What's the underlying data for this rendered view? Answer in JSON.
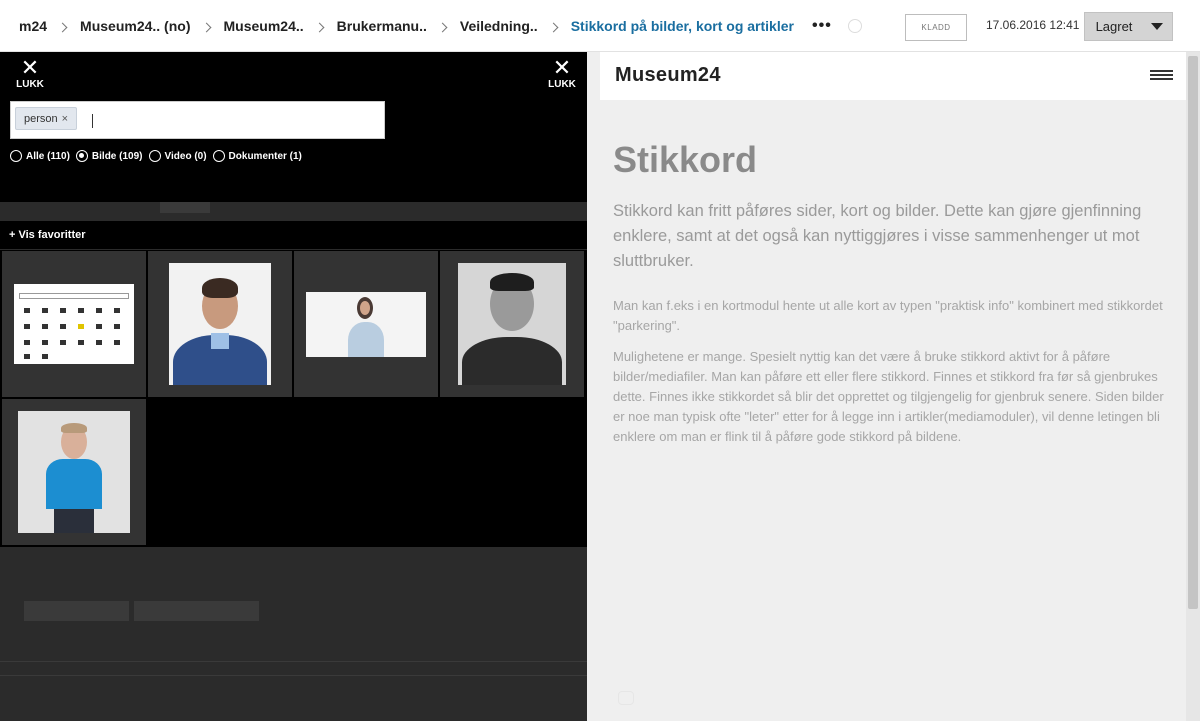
{
  "breadcrumb": {
    "items": [
      "m24",
      "Museum24.. (no)",
      "Museum24..",
      "Brukermanu..",
      "Veiledning.."
    ],
    "current": "Stikkord på bilder, kort og artikler",
    "more": "•••"
  },
  "topbar": {
    "status_badge": "KLADD",
    "saved_time": "17.06.2016 12:41",
    "saved_label": "Lagret"
  },
  "picker": {
    "close_label": "LUKK",
    "tag": "person",
    "filters": [
      {
        "label": "Alle (110)",
        "selected": false
      },
      {
        "label": "Bilde (109)",
        "selected": true
      },
      {
        "label": "Video (0)",
        "selected": false
      },
      {
        "label": "Dokumenter (1)",
        "selected": false
      }
    ],
    "favorites_toggle": "+ Vis favoritter",
    "thumbnails": [
      {
        "kind": "screenshot"
      },
      {
        "kind": "portrait-man-blue-sweater"
      },
      {
        "kind": "portrait-woman-light-blouse"
      },
      {
        "kind": "portrait-man-bw"
      },
      {
        "kind": "portrait-man-blue-shirt"
      }
    ]
  },
  "preview": {
    "logo": "Museum24",
    "title": "Stikkord",
    "lead": "Stikkord kan fritt påføres sider, kort og bilder. Dette kan gjøre gjenfinning enklere, samt at det også kan nyttiggjøres i visse sammenhenger ut mot sluttbruker.",
    "paragraph1": "Man kan f.eks i en kortmodul hente ut alle kort av typen \"praktisk info\" kombinert med stikkordet \"parkering\".",
    "paragraph2": "Mulighetene er mange. Spesielt nyttig kan det være å bruke stikkord aktivt for å påføre bilder/mediafiler. Man kan påføre ett eller flere stikkord. Finnes et stikkord fra før så gjenbrukes dette. Finnes ikke stikkordet så blir det opprettet og tilgjengelig for gjenbruk senere.  Siden bilder er noe man typisk ofte \"leter\" etter for å legge inn i artikler(mediamoduler), vil denne letingen bli enklere om man er flink til å påføre gode stikkord på bildene."
  },
  "colors": {
    "accent": "#1a6ea0",
    "overlay": "#000000",
    "preview_bg": "#efefef"
  }
}
